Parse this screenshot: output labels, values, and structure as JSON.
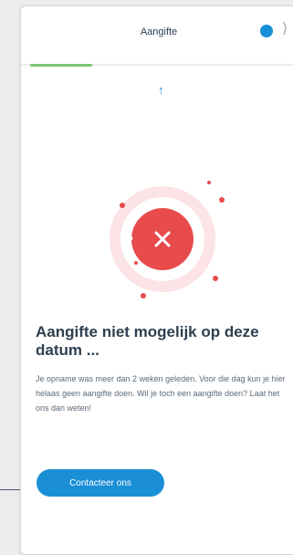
{
  "header": {
    "title": "Aangifte",
    "close_glyph": "⟩"
  },
  "progress": {
    "fraction": 0.22
  },
  "error": {
    "title": "Aangifte niet mogelijk op deze datum ...",
    "message": "Je opname was meer dan 2 weken geleden. Voor die dag kun je hier helaas geen aangifte doen. Wil je toch een aangifte doen? Laat het ons dan weten!"
  },
  "actions": {
    "contact_label": "Contacteer ons"
  },
  "colors": {
    "brand_blue": "#1a8fd6",
    "error_red": "#e84b4b",
    "progress_green": "#7cc576"
  },
  "icons": {
    "help": "help-icon",
    "close": "close-icon",
    "up_arrow": "up-arrow-icon",
    "error": "error-x-icon"
  }
}
